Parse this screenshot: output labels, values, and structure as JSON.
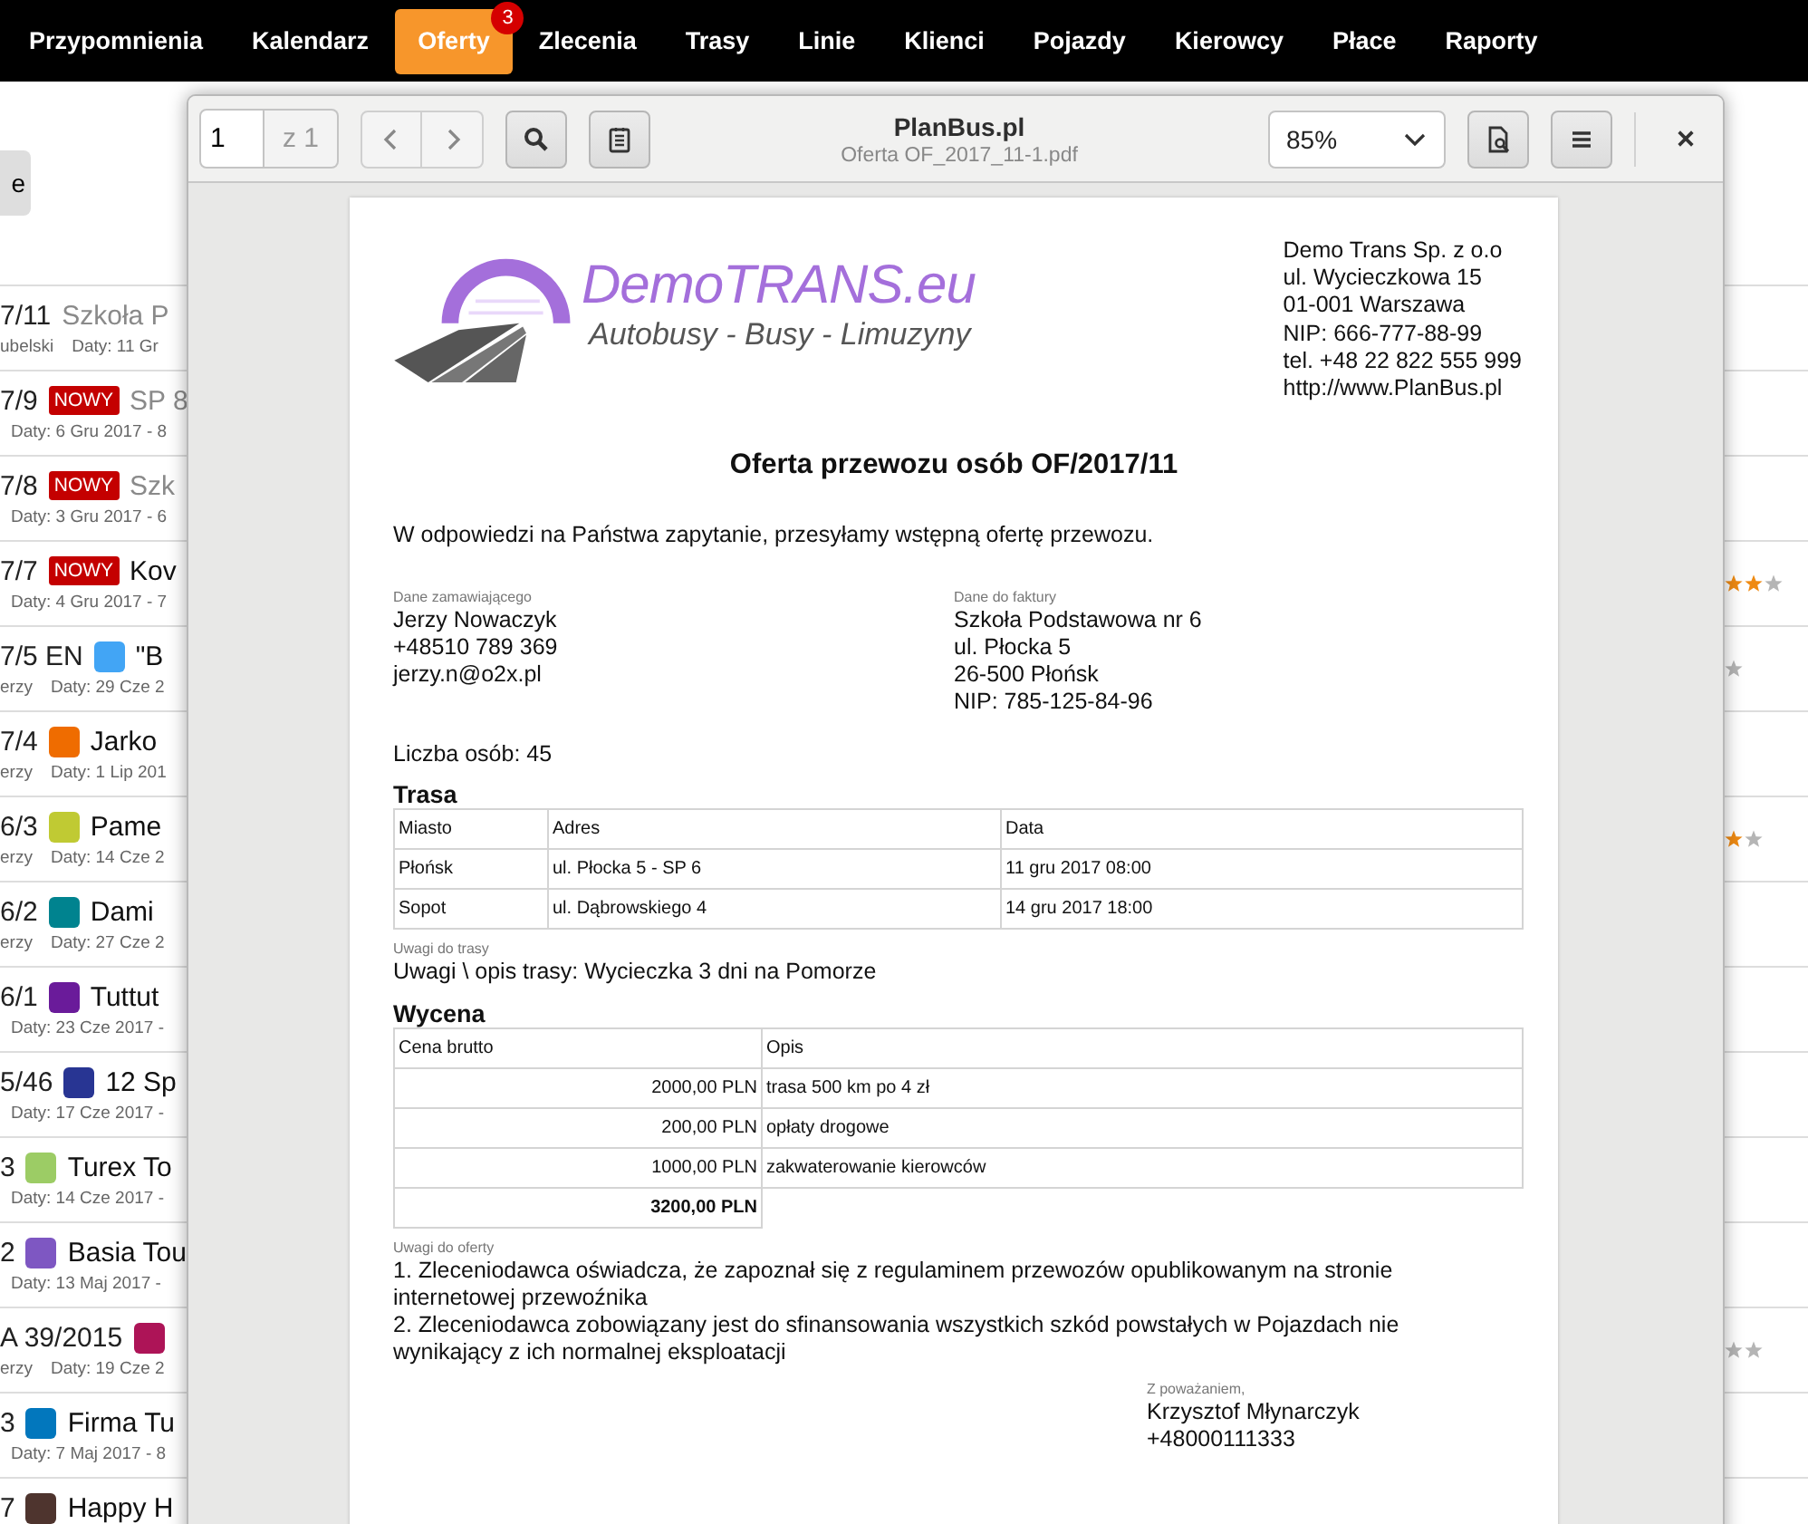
{
  "nav": {
    "items": [
      {
        "label": "Przypomnienia",
        "selected": false
      },
      {
        "label": "Kalendarz",
        "selected": false
      },
      {
        "label": "Oferty",
        "selected": true,
        "badge": "3"
      },
      {
        "label": "Zlecenia",
        "selected": false
      },
      {
        "label": "Trasy",
        "selected": false
      },
      {
        "label": "Linie",
        "selected": false
      },
      {
        "label": "Klienci",
        "selected": false
      },
      {
        "label": "Pojazdy",
        "selected": false
      },
      {
        "label": "Kierowcy",
        "selected": false
      },
      {
        "label": "Płace",
        "selected": false
      },
      {
        "label": "Raporty",
        "selected": false
      }
    ]
  },
  "side_button": {
    "label": "e"
  },
  "offers": [
    {
      "number": "7/11",
      "name": "Szkoła P",
      "muted": true,
      "client": "ubelski",
      "dates": "Daty: 11 Gr"
    },
    {
      "number": "7/9",
      "badge": "NOWY",
      "name": "SP 8",
      "muted": true,
      "dates": "Daty: 6 Gru 2017 - 8"
    },
    {
      "number": "7/8",
      "badge": "NOWY",
      "name": "Szk",
      "muted": true,
      "dates": "Daty: 3 Gru 2017 - 6"
    },
    {
      "number": "7/7",
      "badge": "NOWY",
      "name": "Kov",
      "muted": false,
      "dates": "Daty: 4 Gru 2017 - 7",
      "rating": [
        {
          "filled": true
        },
        {
          "filled": true
        },
        {
          "filled": false
        }
      ]
    },
    {
      "number": "7/5 EN",
      "color": "#42a5f5",
      "name": "\"B",
      "muted": false,
      "client": "erzy",
      "dates": "Daty: 29 Cze 2",
      "rating": [
        {
          "filled": false
        }
      ]
    },
    {
      "number": "7/4",
      "color": "#ef6c00",
      "name": "Jarko",
      "muted": false,
      "client": "erzy",
      "dates": "Daty: 1 Lip 201"
    },
    {
      "number": "6/3",
      "color": "#c0ca33",
      "name": "Pame",
      "muted": false,
      "client": "erzy",
      "dates": "Daty: 14 Cze 2",
      "rating": [
        {
          "filled": true
        },
        {
          "filled": false
        }
      ]
    },
    {
      "number": "6/2",
      "color": "#00838f",
      "name": "Dami",
      "muted": false,
      "client": "erzy",
      "dates": "Daty: 27 Cze 2"
    },
    {
      "number": "6/1",
      "color": "#6a1b9a",
      "name": "Tuttut",
      "muted": false,
      "dates": "Daty: 23 Cze 2017 -"
    },
    {
      "number": "5/46",
      "color": "#283593",
      "name": "12 Sp",
      "muted": false,
      "dates": "Daty: 17 Cze 2017 -"
    },
    {
      "number": "3",
      "color": "#9ccc65",
      "name": "Turex To",
      "muted": false,
      "dates": "Daty: 14 Cze 2017 -"
    },
    {
      "number": "2",
      "color": "#7e57c2",
      "name": "Basia Tou",
      "muted": false,
      "dates": "Daty: 13 Maj 2017 -"
    },
    {
      "number": "A 39/2015",
      "color": "#ad1457",
      "client": "erzy",
      "dates": "Daty: 19 Cze 2",
      "rating": [
        {
          "filled": false
        },
        {
          "filled": false
        }
      ]
    },
    {
      "number": "3",
      "color": "#0277bd",
      "name": "Firma Tu",
      "muted": false,
      "dates": "Daty: 7 Maj 2017 - 8"
    },
    {
      "number": "7",
      "color": "#4e342e",
      "name": "Happy H",
      "muted": false
    }
  ],
  "viewer": {
    "page": "1",
    "page_count": "z 1",
    "title": "PlanBus.pl",
    "filename": "Oferta OF_2017_11-1.pdf",
    "zoom": "85%"
  },
  "document": {
    "logo": {
      "name": "DemoTRANS.eu",
      "tagline": "Autobusy - Busy - Limuzyny"
    },
    "company_lines": [
      "Demo Trans Sp. z o.o",
      "ul. Wycieczkowa 15",
      "01-001 Warszawa",
      "NIP: 666-777-88-99",
      "tel. +48 22 822 555 999",
      "http://www.PlanBus.pl"
    ],
    "title": "Oferta przewozu osób OF/2017/11",
    "intro": "W odpowiedzi na Państwa zapytanie, przesyłamy wstępną ofertę przewozu.",
    "customer": {
      "label": "Dane zamawiającego",
      "lines": [
        "Jerzy Nowaczyk",
        "+48510 789 369",
        "jerzy.n@o2x.pl"
      ]
    },
    "invoice": {
      "label": "Dane do faktury",
      "lines": [
        "Szkoła Podstawowa nr 6",
        "ul. Płocka 5",
        "26-500 Płońsk",
        "NIP: 785-125-84-96"
      ]
    },
    "people": "Liczba osób: 45",
    "route": {
      "heading": "Trasa",
      "columns": [
        "Miasto",
        "Adres",
        "Data"
      ],
      "rows": [
        [
          "Płońsk",
          "ul. Płocka 5 - SP 6",
          "11 gru 2017 08:00"
        ],
        [
          "Sopot",
          "ul. Dąbrowskiego 4",
          "14 gru 2017 18:00"
        ]
      ]
    },
    "route_notes": {
      "label": "Uwagi do trasy",
      "text": "Uwagi \\ opis trasy: Wycieczka 3 dni na Pomorze"
    },
    "pricing": {
      "heading": "Wycena",
      "columns": [
        "Cena brutto",
        "Opis"
      ],
      "rows": [
        {
          "kind": "item",
          "price": "2000,00 PLN",
          "description": "trasa 500 km po 4 zł"
        },
        {
          "kind": "item",
          "price": "200,00 PLN",
          "description": "opłaty drogowe"
        },
        {
          "kind": "item",
          "price": "1000,00 PLN",
          "description": "zakwaterowanie kierowców"
        },
        {
          "kind": "total",
          "price": "3200,00 PLN"
        }
      ]
    },
    "offer_notes": {
      "label": "Uwagi do oferty",
      "lines": [
        "1. Zleceniodawca oświadcza, że zapoznał się z regulaminem przewozów opublikowanym na stronie internetowej przewoźnika",
        "2. Zleceniodawca zobowiązany jest do sfinansowania wszystkich szkód powstałych w Pojazdach nie wynikający z ich normalnej eksploatacji"
      ]
    },
    "signature": {
      "label": "Z poważaniem,",
      "lines": [
        "Krzysztof Młynarczyk",
        "+48000111333"
      ]
    }
  }
}
